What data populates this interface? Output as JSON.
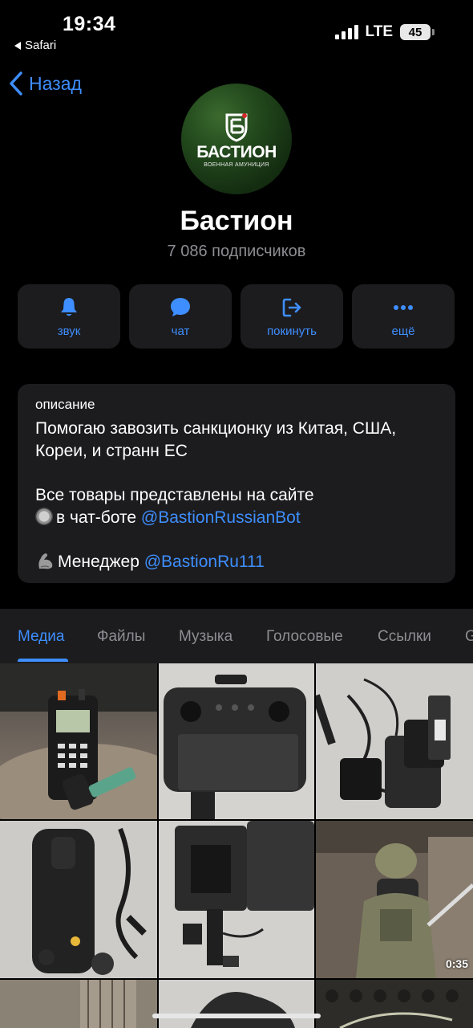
{
  "status_bar": {
    "time": "19:34",
    "back_app": "Safari",
    "network": "LTE",
    "battery": "45"
  },
  "nav": {
    "back_label": "Назад"
  },
  "channel": {
    "avatar_title": "БАСТИОН",
    "avatar_subtitle": "ВОЕННАЯ АМУНИЦИЯ",
    "name": "Бастион",
    "subscribers": "7 086 подписчиков"
  },
  "actions": [
    {
      "label": "звук",
      "icon": "bell-icon"
    },
    {
      "label": "чат",
      "icon": "chat-bubble-icon"
    },
    {
      "label": "покинуть",
      "icon": "leave-icon"
    },
    {
      "label": "ещё",
      "icon": "more-dots-icon"
    }
  ],
  "description": {
    "label": "описание",
    "line1": "Помогаю завозить санкционку из Китая, США, Кореи, и странн ЕС",
    "line2": "Все товары представлены на сайте",
    "line3_prefix": "в чат-боте ",
    "line3_link": "@BastionRussianBot",
    "line4_prefix": "Менеджер ",
    "line4_link": "@BastionRu111"
  },
  "tabs": [
    {
      "label": "Медиа",
      "active": true
    },
    {
      "label": "Файлы",
      "active": false
    },
    {
      "label": "Музыка",
      "active": false
    },
    {
      "label": "Голосовые",
      "active": false
    },
    {
      "label": "Ссылки",
      "active": false
    },
    {
      "label": "GIF",
      "active": false
    }
  ],
  "media": {
    "video_duration": "0:35"
  },
  "colors": {
    "accent": "#3e8eff",
    "card": "#1c1c1e",
    "secondary_text": "#8d8d93"
  }
}
